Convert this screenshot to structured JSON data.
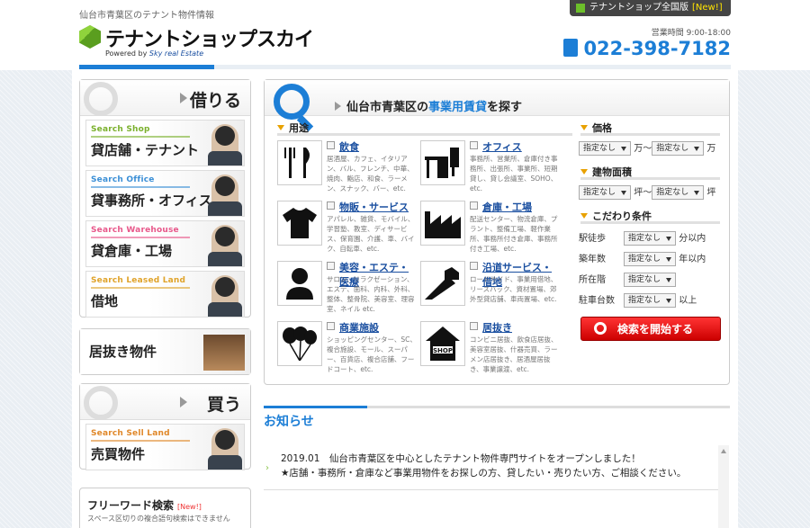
{
  "header": {
    "tagline": "仙台市青葉区のテナント物件情報",
    "logo_text": "テナントショップ",
    "logo_text2": "スカイ",
    "powered_by": "Powered by",
    "powered_brand": "Sky real Estate",
    "national_label": "テナントショップ全国版",
    "national_new": "[New!]",
    "hours": "営業時間 9:00-18:00",
    "phone": "022-398-7182"
  },
  "sidebar": {
    "rent_title": "借りる",
    "items": [
      {
        "en": "Search Shop",
        "jp": "貸店舗・テナント",
        "color": "#7ab02c"
      },
      {
        "en": "Search Office",
        "jp": "貸事務所・オフィス",
        "color": "#3b8fd6"
      },
      {
        "en": "Search Warehouse",
        "jp": "貸倉庫・工場",
        "color": "#e8578a"
      },
      {
        "en": "Search Leased Land",
        "jp": "借地",
        "color": "#e0a32a"
      }
    ],
    "inuki": "居抜き物件",
    "buy_title": "買う",
    "buy_item": {
      "en": "Search Sell Land",
      "jp": "売買物件",
      "color": "#e0882a"
    },
    "free_title": "フリーワード検索",
    "free_new": "[New!]",
    "free_sub": "スペース区切りの複合語句検索はできません"
  },
  "main": {
    "title_pre": "仙台市青葉区の",
    "title_hl": "事業用賃貸",
    "title_post": "を探す",
    "use_label": "用途",
    "uses": [
      {
        "label": "飲食",
        "desc": "居酒屋、カフェ、イタリアン、バル、フレンチ、中華、焼肉、鮨店、和食、ラーメン、スナック、バー、etc.",
        "icon": "fork-knife-icon"
      },
      {
        "label": "オフィス",
        "desc": "事務所、営業所、倉庫付き事務所、出張所、事業所、短期貸し、貸し会議室、SOHO、etc.",
        "icon": "desk-icon"
      },
      {
        "label": "物販・サービス",
        "desc": "アパレル、雑貨、モバイル、学習塾、教室、ディサービス、保育園、介護、車、バイク、自転車、etc.",
        "icon": "tshirt-icon"
      },
      {
        "label": "倉庫・工場",
        "desc": "配送センター、物流倉庫、プラント、整備工場、軽作業所、事務所付き倉庫、事務所付き工場、etc.",
        "icon": "factory-icon"
      },
      {
        "label": "美容・エステ・医療",
        "desc": "サロン、リラクゼーション、エステ、歯科、内科、外科、整体、整骨院、美容室、理容室、ネイル etc.",
        "icon": "person-icon"
      },
      {
        "label": "沿道サービス・借地",
        "desc": "ロードサイド、事業用借地、リースバック、資材置場、郊外型貸店舗、車両置場、etc.",
        "icon": "road-icon"
      },
      {
        "label": "商業施設",
        "desc": "ショッピングセンター、SC、複合施設、モール、スーパー、百貨店、複合店舗、フードコート、etc.",
        "icon": "balloons-icon"
      },
      {
        "label": "居抜き",
        "desc": "コンビニ居抜、飲食店居抜、美容室居抜、什器売買、ラーメン店居抜き、居酒屋居抜き、事業譲渡、etc.",
        "icon": "shop-house-icon"
      }
    ],
    "price_label": "価格",
    "area_label": "建物面積",
    "cond_label": "こだわり条件",
    "unspecified": "指定なし",
    "price_unit1": "万〜",
    "price_unit2": "万",
    "area_unit1": "坪〜",
    "area_unit2": "坪",
    "conds": [
      {
        "label": "駅徒歩",
        "unit": "分以内"
      },
      {
        "label": "築年数",
        "unit": "年以内"
      },
      {
        "label": "所在階",
        "unit": ""
      },
      {
        "label": "駐車台数",
        "unit": "以上"
      }
    ],
    "search_button": "検索を開始する"
  },
  "news": {
    "title": "お知らせ",
    "line1": "2019.01　仙台市青葉区を中心としたテナント物件専門サイトをオープンしました！",
    "line2": "★店舗・事務所・倉庫など事業用物件をお探しの方、貸したい・売りたい方、ご相談ください。"
  }
}
